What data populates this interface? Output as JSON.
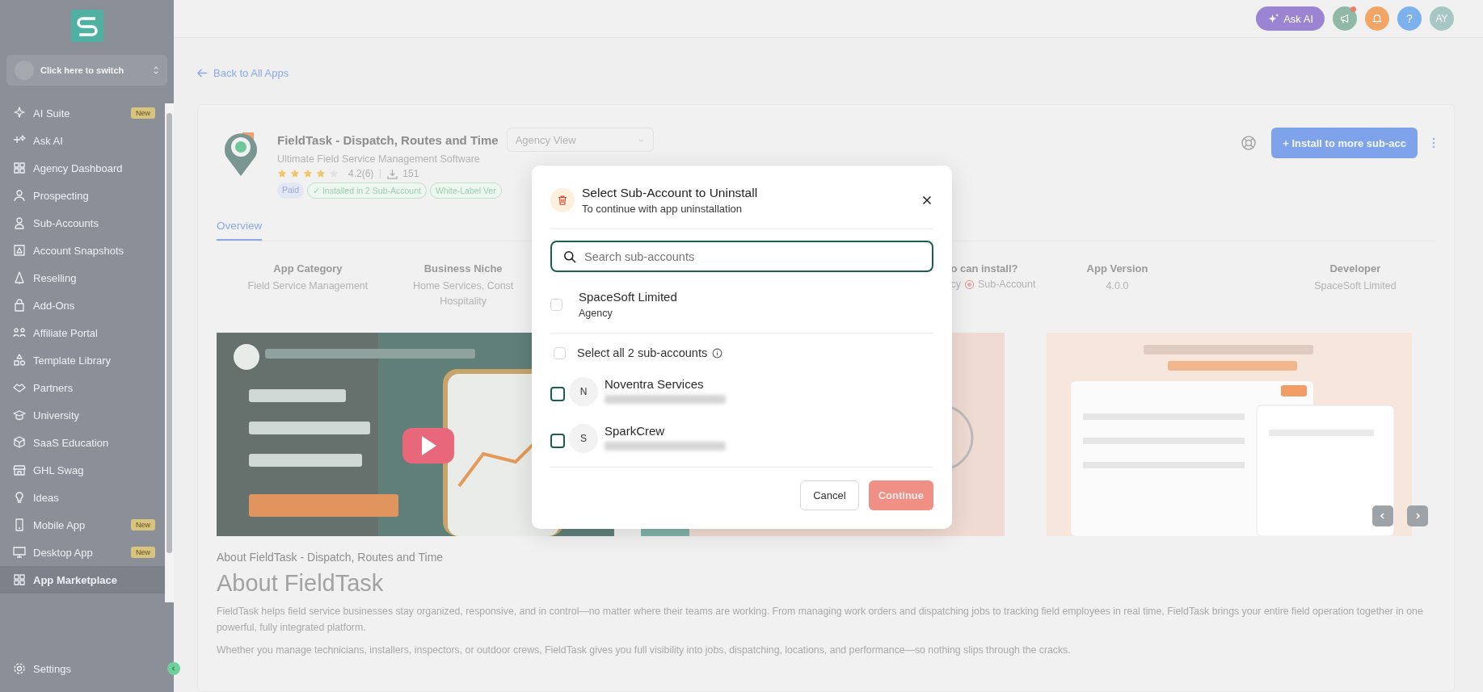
{
  "top_bar": {
    "ask_ai": "Ask AI",
    "help": "?",
    "avatar": "AY"
  },
  "sidebar": {
    "switcher": "Click here to switch",
    "items": [
      {
        "label": "AI Suite",
        "badge": "New",
        "selected": false
      },
      {
        "label": "Ask AI",
        "selected": false
      },
      {
        "label": "Agency Dashboard",
        "selected": false
      },
      {
        "label": "Prospecting",
        "selected": false
      },
      {
        "label": "Sub-Accounts",
        "selected": false
      },
      {
        "label": "Account Snapshots",
        "selected": false
      },
      {
        "label": "Reselling",
        "selected": false
      },
      {
        "label": "Add-Ons",
        "selected": false
      },
      {
        "label": "Affiliate Portal",
        "selected": false
      },
      {
        "label": "Template Library",
        "selected": false
      },
      {
        "label": "Partners",
        "selected": false
      },
      {
        "label": "University",
        "selected": false
      },
      {
        "label": "SaaS Education",
        "selected": false
      },
      {
        "label": "GHL Swag",
        "selected": false
      },
      {
        "label": "Ideas",
        "selected": false
      },
      {
        "label": "Mobile App",
        "badge": "New",
        "selected": false
      },
      {
        "label": "Desktop App",
        "badge": "New",
        "selected": false
      },
      {
        "label": "App Marketplace",
        "selected": true
      }
    ],
    "settings": "Settings"
  },
  "back_link": "Back to All Apps",
  "app": {
    "name": "FieldTask - Dispatch, Routes and Time",
    "view_select": "Agency View",
    "tagline": "Ultimate Field Service Management Software",
    "stars": 4,
    "rating": "4.2(6)",
    "installs": "151",
    "tags": [
      {
        "label": "Paid",
        "kind": "price"
      },
      {
        "label": "✓ Installed in 2 Sub-Account",
        "kind": "status"
      },
      {
        "label": "White-Label Ver",
        "kind": "status"
      }
    ],
    "install_button": "+ Install to more sub-acc"
  },
  "tabs": [
    {
      "label": "Overview",
      "selected": true
    }
  ],
  "info": [
    {
      "label": "App Category",
      "lines": [
        "Field Service Management"
      ],
      "kind": "text"
    },
    {
      "label": "Business Niche",
      "lines": [
        "Home Services, Const",
        "Hospitality"
      ],
      "kind": "text"
    },
    {
      "label": "o can install?",
      "lines": [
        "cy",
        "Sub-Account"
      ],
      "kind": "scope"
    },
    {
      "label": "App Version",
      "lines": [
        "4.0.0"
      ],
      "kind": "text"
    },
    {
      "label": "Developer",
      "lines": [
        "SpaceSoft Limited"
      ],
      "kind": "text"
    }
  ],
  "about": {
    "heading": "About FieldTask - Dispatch, Routes and Time",
    "title": "About FieldTask",
    "paragraphs": [
      "FieldTask helps field service businesses stay organized, responsive, and in control—no matter where their teams are working. From managing work orders and dispatching jobs to tracking field employees in real time, FieldTask brings your entire field operation together in one powerful, fully integrated platform.",
      "Whether you manage technicians, installers, inspectors, or outdoor crews, FieldTask gives you full visibility into jobs, dispatching, locations, and performance—so nothing slips through the cracks."
    ]
  },
  "modal": {
    "title": "Select Sub-Account to Uninstall",
    "subtitle": "To continue with app uninstallation",
    "search": {
      "placeholder": "Search sub-accounts"
    },
    "agency": {
      "name": "SpaceSoft Limited",
      "type": "Agency",
      "checked": false
    },
    "select_all": {
      "label": "Select all 2 sub-accounts",
      "checked": false
    },
    "accounts": [
      {
        "initial": "N",
        "name": "Noventra Services",
        "checked": false
      },
      {
        "initial": "S",
        "name": "SparkCrew",
        "checked": false
      }
    ],
    "cancel": "Cancel",
    "continue": "Continue",
    "continue_disabled": true
  }
}
